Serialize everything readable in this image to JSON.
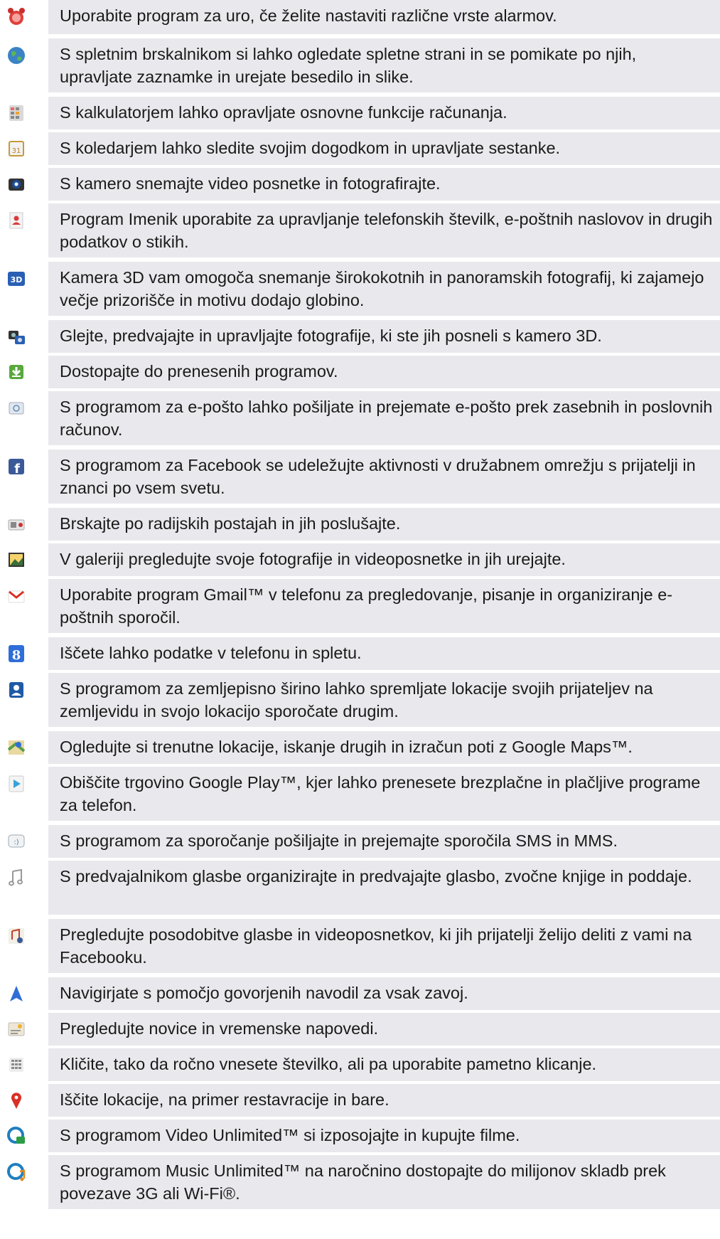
{
  "items": [
    {
      "icon": "alarm-clock-icon",
      "text": "Uporabite program za uro, če želite nastaviti različne vrste alarmov."
    },
    {
      "icon": "globe-icon",
      "text": "S spletnim brskalnikom si lahko ogledate spletne strani in se pomikate po njih, upravljate zaznamke in urejate besedilo in slike."
    },
    {
      "icon": "calculator-icon",
      "text": "S kalkulatorjem lahko opravljate osnovne funkcije računanja."
    },
    {
      "icon": "calendar-icon",
      "text": "S koledarjem lahko sledite svojim dogodkom in upravljate sestanke."
    },
    {
      "icon": "camera-icon",
      "text": "S kamero snemajte video posnetke in fotografirajte."
    },
    {
      "icon": "contacts-icon",
      "text": "Program Imenik uporabite za upravljanje telefonskih številk, e-poštnih naslovov in drugih podatkov o stikih."
    },
    {
      "icon": "camera-3d-icon",
      "text": "Kamera 3D vam omogoča snemanje širokokotnih in panoramskih fotografij, ki zajamejo večje prizorišče in motivu dodajo globino."
    },
    {
      "icon": "3d-viewer-icon",
      "text": "Glejte, predvajajte in upravljajte fotografije, ki ste jih posneli s kamero 3D."
    },
    {
      "icon": "download-icon",
      "text": "Dostopajte do prenesenih programov."
    },
    {
      "icon": "email-icon",
      "text": "S programom za e-pošto lahko pošiljate in prejemate e-pošto prek zasebnih in poslovnih računov."
    },
    {
      "icon": "facebook-icon",
      "text": "S programom za Facebook se udeležujte aktivnosti v družabnem omrežju s prijatelji in znanci po vsem svetu."
    },
    {
      "icon": "radio-icon",
      "text": "Brskajte po radijskih postajah in jih poslušajte."
    },
    {
      "icon": "gallery-icon",
      "text": "V galeriji pregledujte svoje fotografije in videoposnetke in jih urejajte."
    },
    {
      "icon": "gmail-icon",
      "text": "Uporabite program Gmail™ v telefonu za pregledovanje, pisanje in organiziranje e-poštnih sporočil."
    },
    {
      "icon": "google-search-icon",
      "text": "Iščete lahko podatke v telefonu in spletu."
    },
    {
      "icon": "latitude-icon",
      "text": "S programom za zemljepisno širino lahko spremljate lokacije svojih prijateljev na zemljevidu in svojo lokacijo sporočate drugim."
    },
    {
      "icon": "maps-icon",
      "text": "Ogledujte si trenutne lokacije, iskanje drugih in izračun poti z Google Maps™."
    },
    {
      "icon": "play-store-icon",
      "text": "Obiščite trgovino Google Play™, kjer lahko prenesete brezplačne in plačljive programe za telefon."
    },
    {
      "icon": "messaging-icon",
      "text": "S programom za sporočanje pošiljajte in prejemajte sporočila SMS in MMS."
    },
    {
      "icon": "music-note-icon",
      "text": "S predvajalnikom glasbe organizirajte in predvajajte glasbo, zvočne knjige in poddaje."
    },
    {
      "icon": "friends-music-icon",
      "text": "Pregledujte posodobitve glasbe in videoposnetkov, ki jih prijatelji želijo deliti z vami na Facebooku."
    },
    {
      "icon": "navigation-icon",
      "text": "Navigirjate s pomočjo govorjenih navodil za vsak zavoj."
    },
    {
      "icon": "news-weather-icon",
      "text": "Pregledujte novice in vremenske napovedi."
    },
    {
      "icon": "dialer-icon",
      "text": "Kličite, tako da ročno vnesete številko, ali pa uporabite pametno klicanje."
    },
    {
      "icon": "location-pin-icon",
      "text": "Iščite lokacije, na primer restavracije in bare."
    },
    {
      "icon": "video-unlimited-icon",
      "text": "S programom Video Unlimited™ si izposojajte in kupujte filme."
    },
    {
      "icon": "music-unlimited-icon",
      "text": "S programom Music Unlimited™ na naročnino dostopajte do milijonov skladb prek povezave 3G ali Wi-Fi®."
    }
  ]
}
